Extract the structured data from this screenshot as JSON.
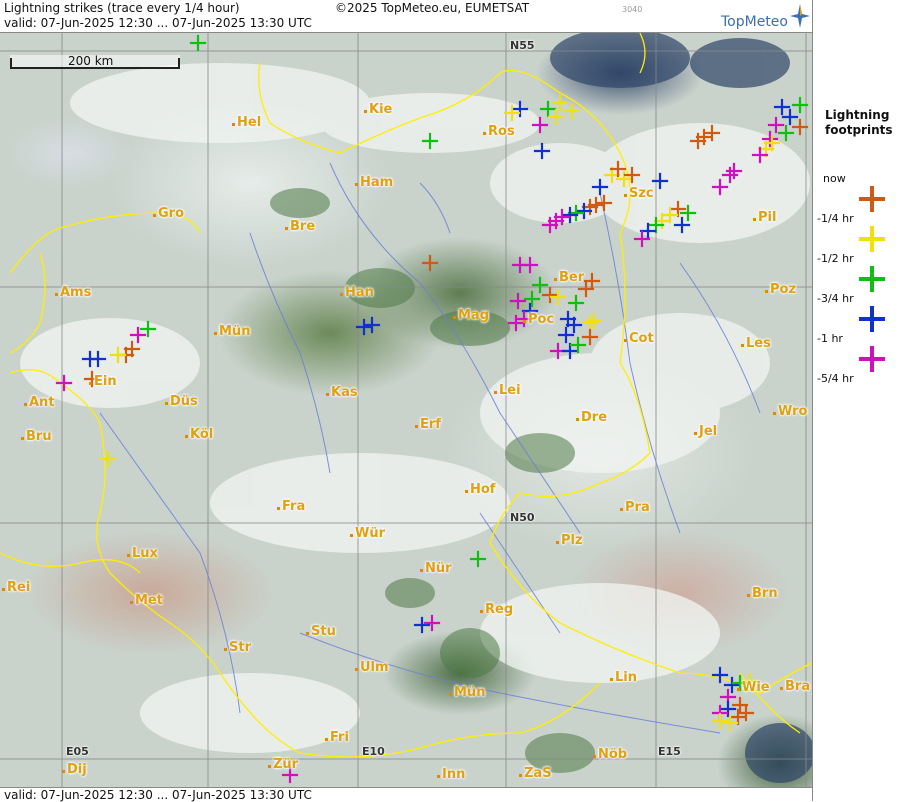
{
  "header": {
    "title": "Lightning strikes (trace every 1/4 hour)",
    "copyright": "©2025 TopMeteo.eu, EUMETSAT",
    "code": "3040",
    "valid": "valid:  07-Jun-2025 12:30 ... 07-Jun-2025 13:30 UTC",
    "logo_text": "TopMeteo"
  },
  "footer": {
    "valid": "valid:  07-Jun-2025 12:30 ... 07-Jun-2025 13:30 UTC"
  },
  "scale": {
    "label": "200 km"
  },
  "grid_labels": {
    "n55": "N55",
    "n50": "N50",
    "e05": "E05",
    "e10": "E10",
    "e15": "E15"
  },
  "cities": [
    "Hel",
    "Kie",
    "Ros",
    "Ham",
    "Gro",
    "Bre",
    "Szc",
    "Pil",
    "Ber",
    "Han",
    "Ams",
    "Mün",
    "Mag",
    "Poc",
    "Cot",
    "Poz",
    "Les",
    "Ein",
    "Ant",
    "Kas",
    "Düs",
    "Lei",
    "Bru",
    "Köl",
    "Erf",
    "Dre",
    "Wro",
    "Jel",
    "Hof",
    "Fra",
    "Pra",
    "Wür",
    "Lux",
    "Plz",
    "Nür",
    "Rei",
    "Met",
    "Reg",
    "Brn",
    "Str",
    "Stu",
    "Ulm",
    "Lin",
    "Wie",
    "Bra",
    "Mün",
    "Fri",
    "Dij",
    "Zür",
    "Inn",
    "ZaS",
    "Nöb"
  ],
  "legend": {
    "title_line1": "Lightning",
    "title_line2": "footprints",
    "items": [
      {
        "label": "now",
        "color": "#d05a10"
      },
      {
        "label": "-1/4 hr",
        "color": "#f0e010"
      },
      {
        "label": "-1/2 hr",
        "color": "#10c010"
      },
      {
        "label": "-3/4 hr",
        "color": "#1030d0"
      },
      {
        "label": "-1 hr",
        "color": "#d010c0"
      },
      {
        "label": "-5/4 hr",
        "color": ""
      }
    ]
  },
  "colors": {
    "border": "#ffee00",
    "river": "#6b7fd6",
    "grid": "#888888",
    "city": "#e0a010"
  }
}
